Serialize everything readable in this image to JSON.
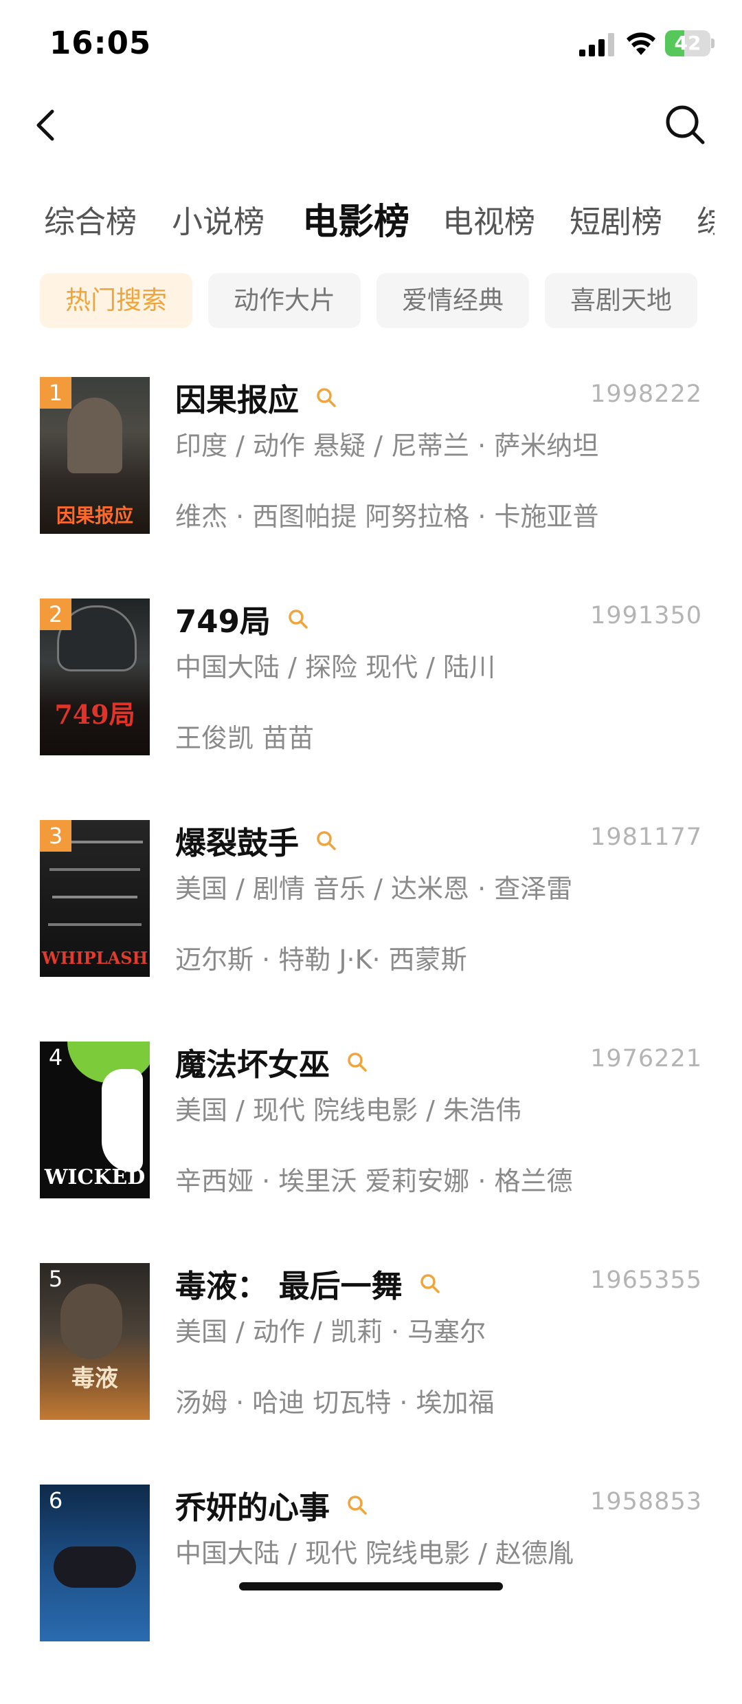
{
  "status_bar": {
    "time": "16:05",
    "battery_level": "42",
    "battery_fraction": 0.42
  },
  "nav": {
    "back_icon": "chevron-left-icon",
    "search_icon": "search-icon"
  },
  "tabs": [
    "综合榜",
    "小说榜",
    "电影榜",
    "电视榜",
    "短剧榜",
    "综"
  ],
  "active_tab": "电影榜",
  "chips": [
    "热门搜索",
    "动作大片",
    "爱情经典",
    "喜剧天地"
  ],
  "active_chip": "热门搜索",
  "colors": {
    "accent": "#f0a53c",
    "rank_badge": "#f39a3a",
    "chip_active_bg": "#fff3e3",
    "battery": "#56c85a"
  },
  "movies": [
    {
      "rank": "1",
      "title": "因果报应",
      "score": "1998222",
      "meta": "印度 / 动作 悬疑 / 尼蒂兰 · 萨米纳坦",
      "cast": "维杰 · 西图帕提 阿努拉格 · 卡施亚普",
      "poster_title": "因果报应"
    },
    {
      "rank": "2",
      "title": "749局",
      "score": "1991350",
      "meta": "中国大陆 / 探险 现代 / 陆川",
      "cast": "王俊凯 苗苗",
      "poster_title": "749局"
    },
    {
      "rank": "3",
      "title": "爆裂鼓手",
      "score": "1981177",
      "meta": "美国 / 剧情 音乐 / 达米恩 · 查泽雷",
      "cast": "迈尔斯 · 特勒 J·K· 西蒙斯",
      "poster_title": "WHIPLASH"
    },
    {
      "rank": "4",
      "title": "魔法坏女巫",
      "score": "1976221",
      "meta": "美国 / 现代 院线电影 / 朱浩伟",
      "cast": "辛西娅 · 埃里沃 爱莉安娜 · 格兰德",
      "poster_title": "WICKED"
    },
    {
      "rank": "5",
      "title": "毒液： 最后一舞",
      "score": "1965355",
      "meta": "美国 / 动作 / 凯莉 · 马塞尔",
      "cast": "汤姆 · 哈迪 切瓦特 · 埃加福",
      "poster_title": "毒液"
    },
    {
      "rank": "6",
      "title": "乔妍的心事",
      "score": "1958853",
      "meta": "中国大陆 / 现代 院线电影 / 赵德胤",
      "cast": "",
      "poster_title": ""
    }
  ]
}
